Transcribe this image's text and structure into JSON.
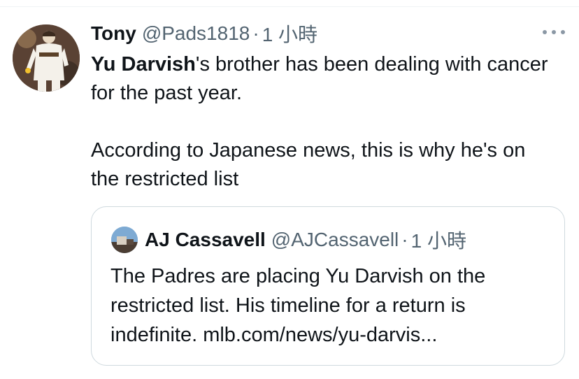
{
  "tweet": {
    "author_name": "Tony",
    "author_handle": "@Pads1818",
    "separator": "·",
    "time": "1 小時",
    "text_bold": "Yu Darvish",
    "text_line1_rest": "'s brother has been dealing with cancer for the past year.",
    "text_paragraph2": "According to Japanese news, this is why he's on the restricted list"
  },
  "quote": {
    "author_name": "AJ Cassavell",
    "author_handle": "@AJCassavell",
    "separator": "·",
    "time": "1 小時",
    "text": "The Padres are placing Yu Darvish on the restricted list. His timeline for a return is indefinite. mlb.com/news/yu-darvis..."
  },
  "icons": {
    "more": "more-horizontal-icon"
  },
  "colors": {
    "text_primary": "#0f1419",
    "text_secondary": "#536471",
    "border": "#cfd9de"
  }
}
